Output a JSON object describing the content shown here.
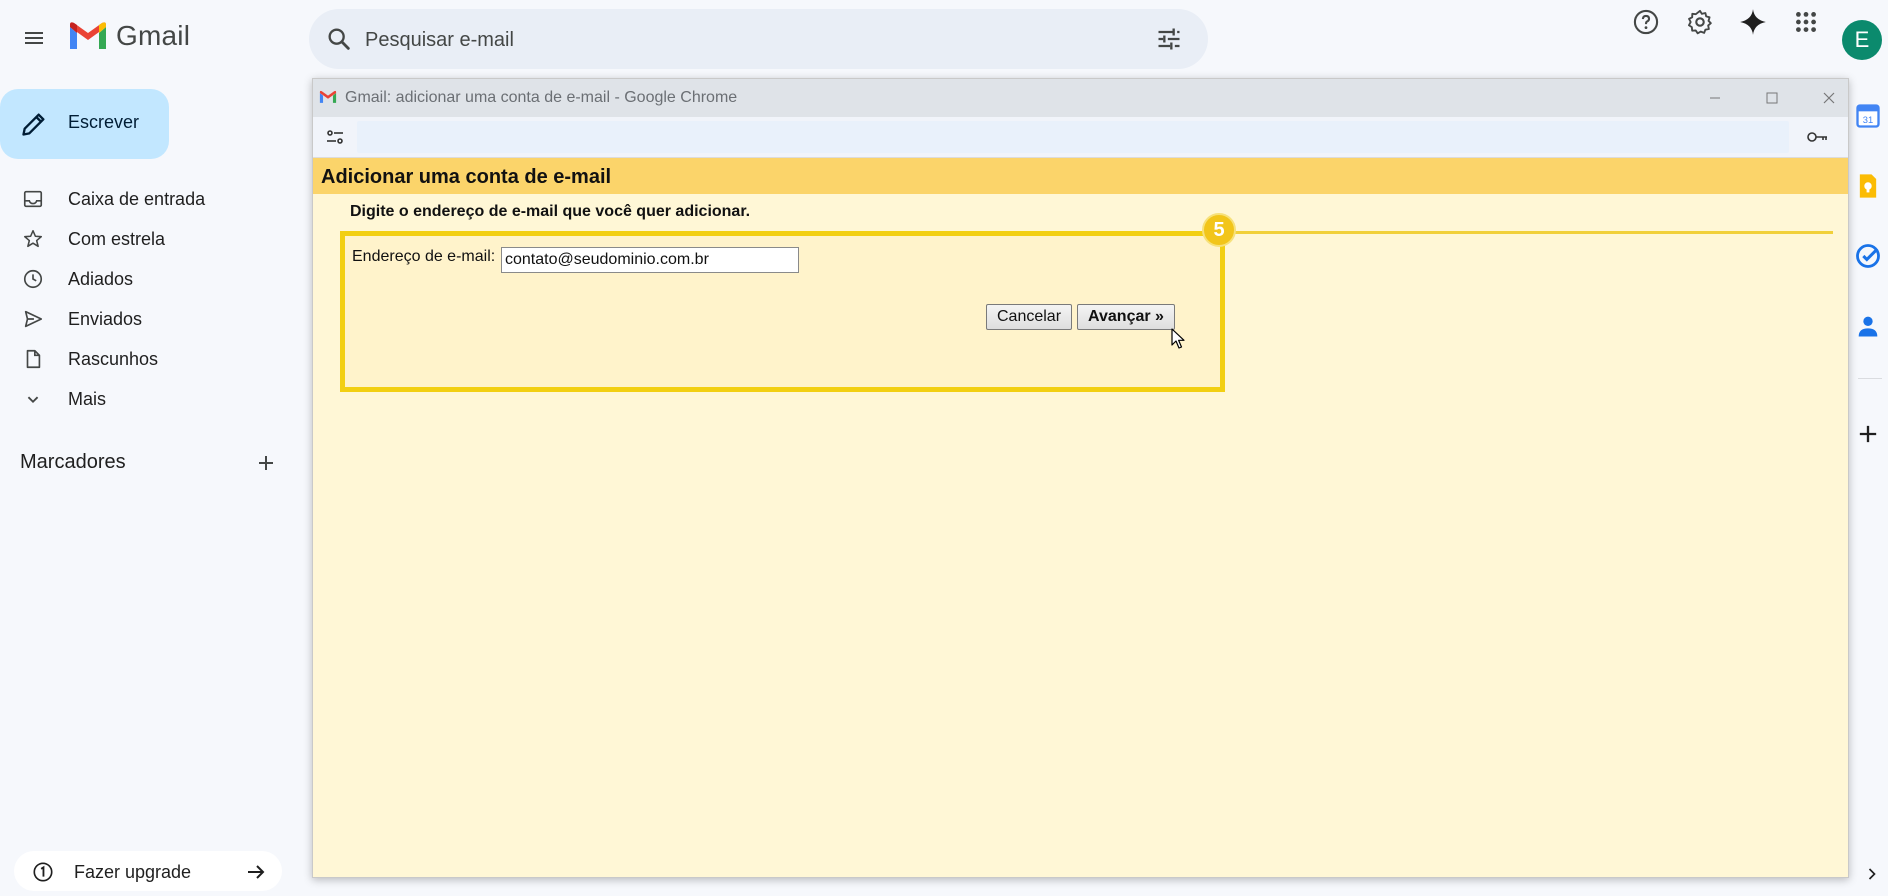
{
  "app": {
    "name": "Gmail",
    "search_placeholder": "Pesquisar e-mail",
    "avatar_letter": "E",
    "accent": "#c2e7ff"
  },
  "sidebar": {
    "compose_label": "Escrever",
    "items": [
      {
        "label": "Caixa de entrada",
        "icon": "inbox-icon"
      },
      {
        "label": "Com estrela",
        "icon": "star-icon"
      },
      {
        "label": "Adiados",
        "icon": "clock-icon"
      },
      {
        "label": "Enviados",
        "icon": "send-icon"
      },
      {
        "label": "Rascunhos",
        "icon": "draft-icon"
      },
      {
        "label": "Mais",
        "icon": "chevron-down-icon"
      }
    ],
    "labels_heading": "Marcadores",
    "upgrade_label": "Fazer upgrade"
  },
  "popup": {
    "window_title": "Gmail: adicionar uma conta de e-mail - Google Chrome",
    "page_title": "Adicionar uma conta de e-mail",
    "instruction": "Digite o endereço de e-mail que você quer adicionar.",
    "step_number": "5",
    "field_label": "Endereço de e-mail:",
    "email_value": "contato@seudominio.com.br",
    "cancel_label": "Cancelar",
    "next_label": "Avançar »",
    "header_color": "#fbd46a",
    "highlight_color": "#f2cf12"
  }
}
